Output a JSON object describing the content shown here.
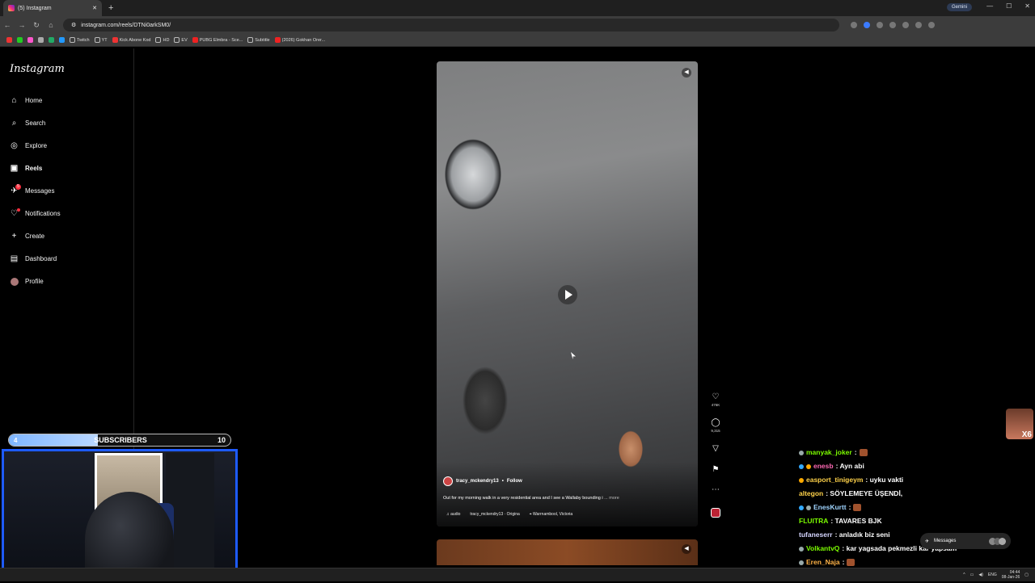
{
  "browser": {
    "tab_title": "(5) Instagram",
    "url": "instagram.com/reels/DTNi0arkSM0/",
    "gemini_label": "Gemini",
    "bookmarks": [
      "Twitch",
      "YT",
      "Kick Abone Kod",
      "HD",
      "EV",
      "PUBG Elmbra - Sce...",
      "Subtitle",
      "(2026) Gokhan Orer..."
    ]
  },
  "sidebar": {
    "logo": "Instagram",
    "items": [
      {
        "label": "Home",
        "icon": "home-icon"
      },
      {
        "label": "Search",
        "icon": "search-icon"
      },
      {
        "label": "Explore",
        "icon": "compass-icon"
      },
      {
        "label": "Reels",
        "icon": "reels-icon"
      },
      {
        "label": "Messages",
        "icon": "messenger-icon",
        "badge": "5"
      },
      {
        "label": "Notifications",
        "icon": "heart-icon"
      },
      {
        "label": "Create",
        "icon": "plus-icon"
      },
      {
        "label": "Dashboard",
        "icon": "dashboard-icon"
      },
      {
        "label": "Profile",
        "icon": "avatar"
      }
    ]
  },
  "reel": {
    "author": "tracy_mckendry13",
    "separator": "•",
    "follow": "Follow",
    "caption": "Out for my morning walk in a very residential area and I see a Wallaby bounding i",
    "more": "... more",
    "audio": "audio",
    "audio_source": "tracy_mckendry13 · Origina",
    "location": "Warrnambool, Victoria",
    "likes": "476K",
    "comments": "9,315"
  },
  "stream": {
    "sub_current": "4",
    "sub_label": "SUBSCRIBERS",
    "sub_goal": "10",
    "sub_progress": 0.4,
    "sticker_text": "X6",
    "chat": [
      {
        "user": "manyak_joker",
        "text": " :",
        "color": "#7CFC00"
      },
      {
        "user": "enesb",
        "text": " : Ayn abi",
        "color": "#FF69B4"
      },
      {
        "user": "easport_tinigeym",
        "text": " : uyku vakti",
        "color": "#ffd24a"
      },
      {
        "user": "altegon",
        "text": " : SÖYLEMEYE ÜŞENDİ,",
        "color": "#ffd24a"
      },
      {
        "user": "EnesKurtt",
        "text": " :",
        "color": "#9fd4ff"
      },
      {
        "user": "FLUITRA",
        "text": " : TAVARES BJK",
        "color": "#7CFC00"
      },
      {
        "user": "tufaneserr",
        "text": " : anladık biz seni",
        "color": "#d6d6ff"
      },
      {
        "user": "VolkantvQ",
        "text": " : kar yagsada pekmezli kar yapsam",
        "color": "#7CFC00"
      },
      {
        "user": "Eren_Naja",
        "text": " :",
        "color": "#ffb347"
      },
      {
        "user": "",
        "text": "",
        "color": "#ff3b3b"
      }
    ],
    "messages_pill": "Messages"
  },
  "taskbar": {
    "lang": "ENG",
    "time": "04:44",
    "date": "08-Jan-26"
  }
}
